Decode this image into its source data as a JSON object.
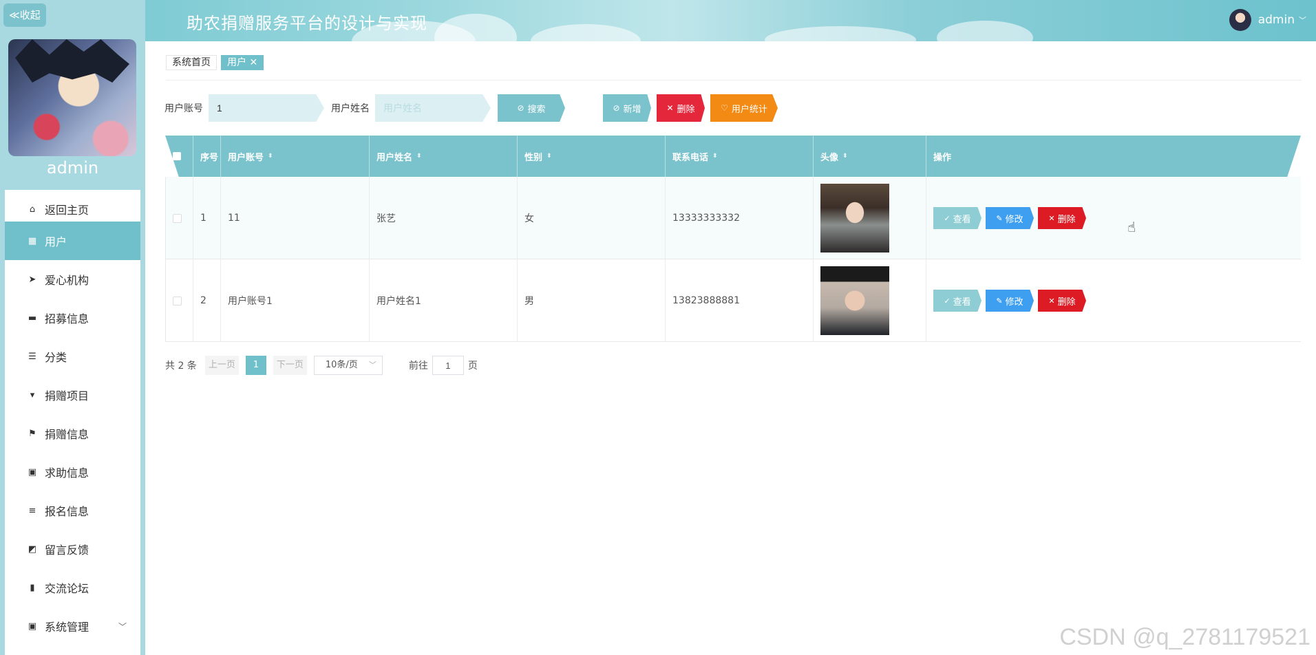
{
  "sidebar": {
    "collapse_label": "≪收起",
    "username": "admin",
    "items": [
      {
        "label": "返回主页",
        "icon": "home-icon",
        "glyph": "⌂"
      },
      {
        "label": "用户",
        "icon": "grid-icon",
        "glyph": "▦"
      },
      {
        "label": "爱心机构",
        "icon": "send-icon",
        "glyph": "➤"
      },
      {
        "label": "招募信息",
        "icon": "box-icon",
        "glyph": "▬"
      },
      {
        "label": "分类",
        "icon": "sliders-icon",
        "glyph": "☰"
      },
      {
        "label": "捐赠项目",
        "icon": "flag-icon",
        "glyph": "▾"
      },
      {
        "label": "捐赠信息",
        "icon": "flag-icon",
        "glyph": "⚑"
      },
      {
        "label": "求助信息",
        "icon": "clipboard-icon",
        "glyph": "▣"
      },
      {
        "label": "报名信息",
        "icon": "list-icon",
        "glyph": "≡"
      },
      {
        "label": "留言反馈",
        "icon": "chart-line-icon",
        "glyph": "◩"
      },
      {
        "label": "交流论坛",
        "icon": "bar-chart-icon",
        "glyph": "▮"
      },
      {
        "label": "系统管理",
        "icon": "clipboard-check-icon",
        "glyph": "▣"
      }
    ]
  },
  "header": {
    "title": "助农捐赠服务平台的设计与实现",
    "user": "admin"
  },
  "breadcrumb": {
    "home": "系统首页",
    "current": "用户 ✕"
  },
  "search": {
    "account_label": "用户账号",
    "account_value": "1",
    "name_label": "用户姓名",
    "name_placeholder": "用户姓名",
    "search_btn": "搜索",
    "add_btn": "新增",
    "delete_btn": "删除",
    "stat_btn": "用户统计"
  },
  "table": {
    "headers": [
      "序号",
      "用户账号",
      "用户姓名",
      "性别",
      "联系电话",
      "头像",
      "操作"
    ],
    "rows": [
      {
        "index": "1",
        "account": "11",
        "name": "张艺",
        "gender": "女",
        "phone": "13333333332"
      },
      {
        "index": "2",
        "account": "用户账号1",
        "name": "用户姓名1",
        "gender": "男",
        "phone": "13823888881"
      }
    ],
    "actions": {
      "view": "查看",
      "edit": "修改",
      "delete": "删除"
    }
  },
  "pagination": {
    "total": "共 2 条",
    "prev": "上一页",
    "page": "1",
    "next": "下一页",
    "size": "10条/页",
    "goto_prefix": "前往",
    "goto_value": "1",
    "goto_suffix": "页"
  },
  "watermark": "CSDN @q_2781179521",
  "colors": {
    "accent": "#6fc0ca",
    "danger": "#dd1b24",
    "edit": "#3e9ff0",
    "orange": "#f28a13"
  }
}
